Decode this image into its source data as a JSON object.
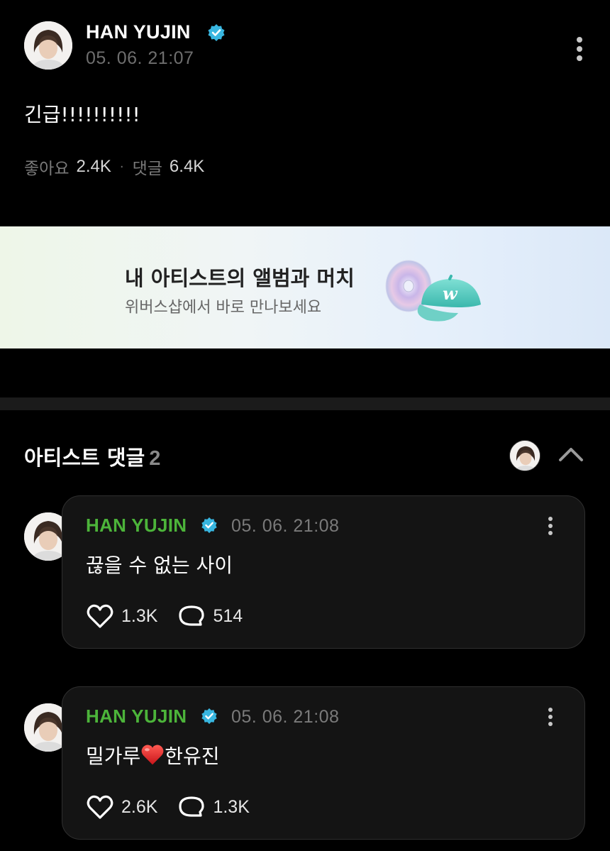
{
  "post": {
    "author": "HAN YUJIN",
    "time": "05. 06. 21:07",
    "body": "긴급!!!!!!!!!!",
    "likes_label": "좋아요",
    "likes_count": "2.4K",
    "separator": "·",
    "comments_label": "댓글",
    "comments_count": "6.4K"
  },
  "banner": {
    "title": "내 아티스트의 앨범과 머치",
    "subtitle": "위버스샵에서 바로 만나보세요",
    "cap_letter": "w"
  },
  "artist_comments": {
    "title": "아티스트 댓글",
    "count": "2",
    "items": [
      {
        "author": "HAN YUJIN",
        "time": "05. 06. 21:08",
        "text": "끊을 수 없는 사이",
        "likes": "1.3K",
        "replies": "514"
      },
      {
        "author": "HAN YUJIN",
        "time": "05. 06. 21:08",
        "text_before": "밀가루",
        "text_after": "한유진",
        "likes": "2.6K",
        "replies": "1.3K"
      }
    ]
  },
  "colors": {
    "background": "#000000",
    "comment_name": "#4cb43a",
    "verified": "#38b6e0",
    "card": "#141414"
  }
}
